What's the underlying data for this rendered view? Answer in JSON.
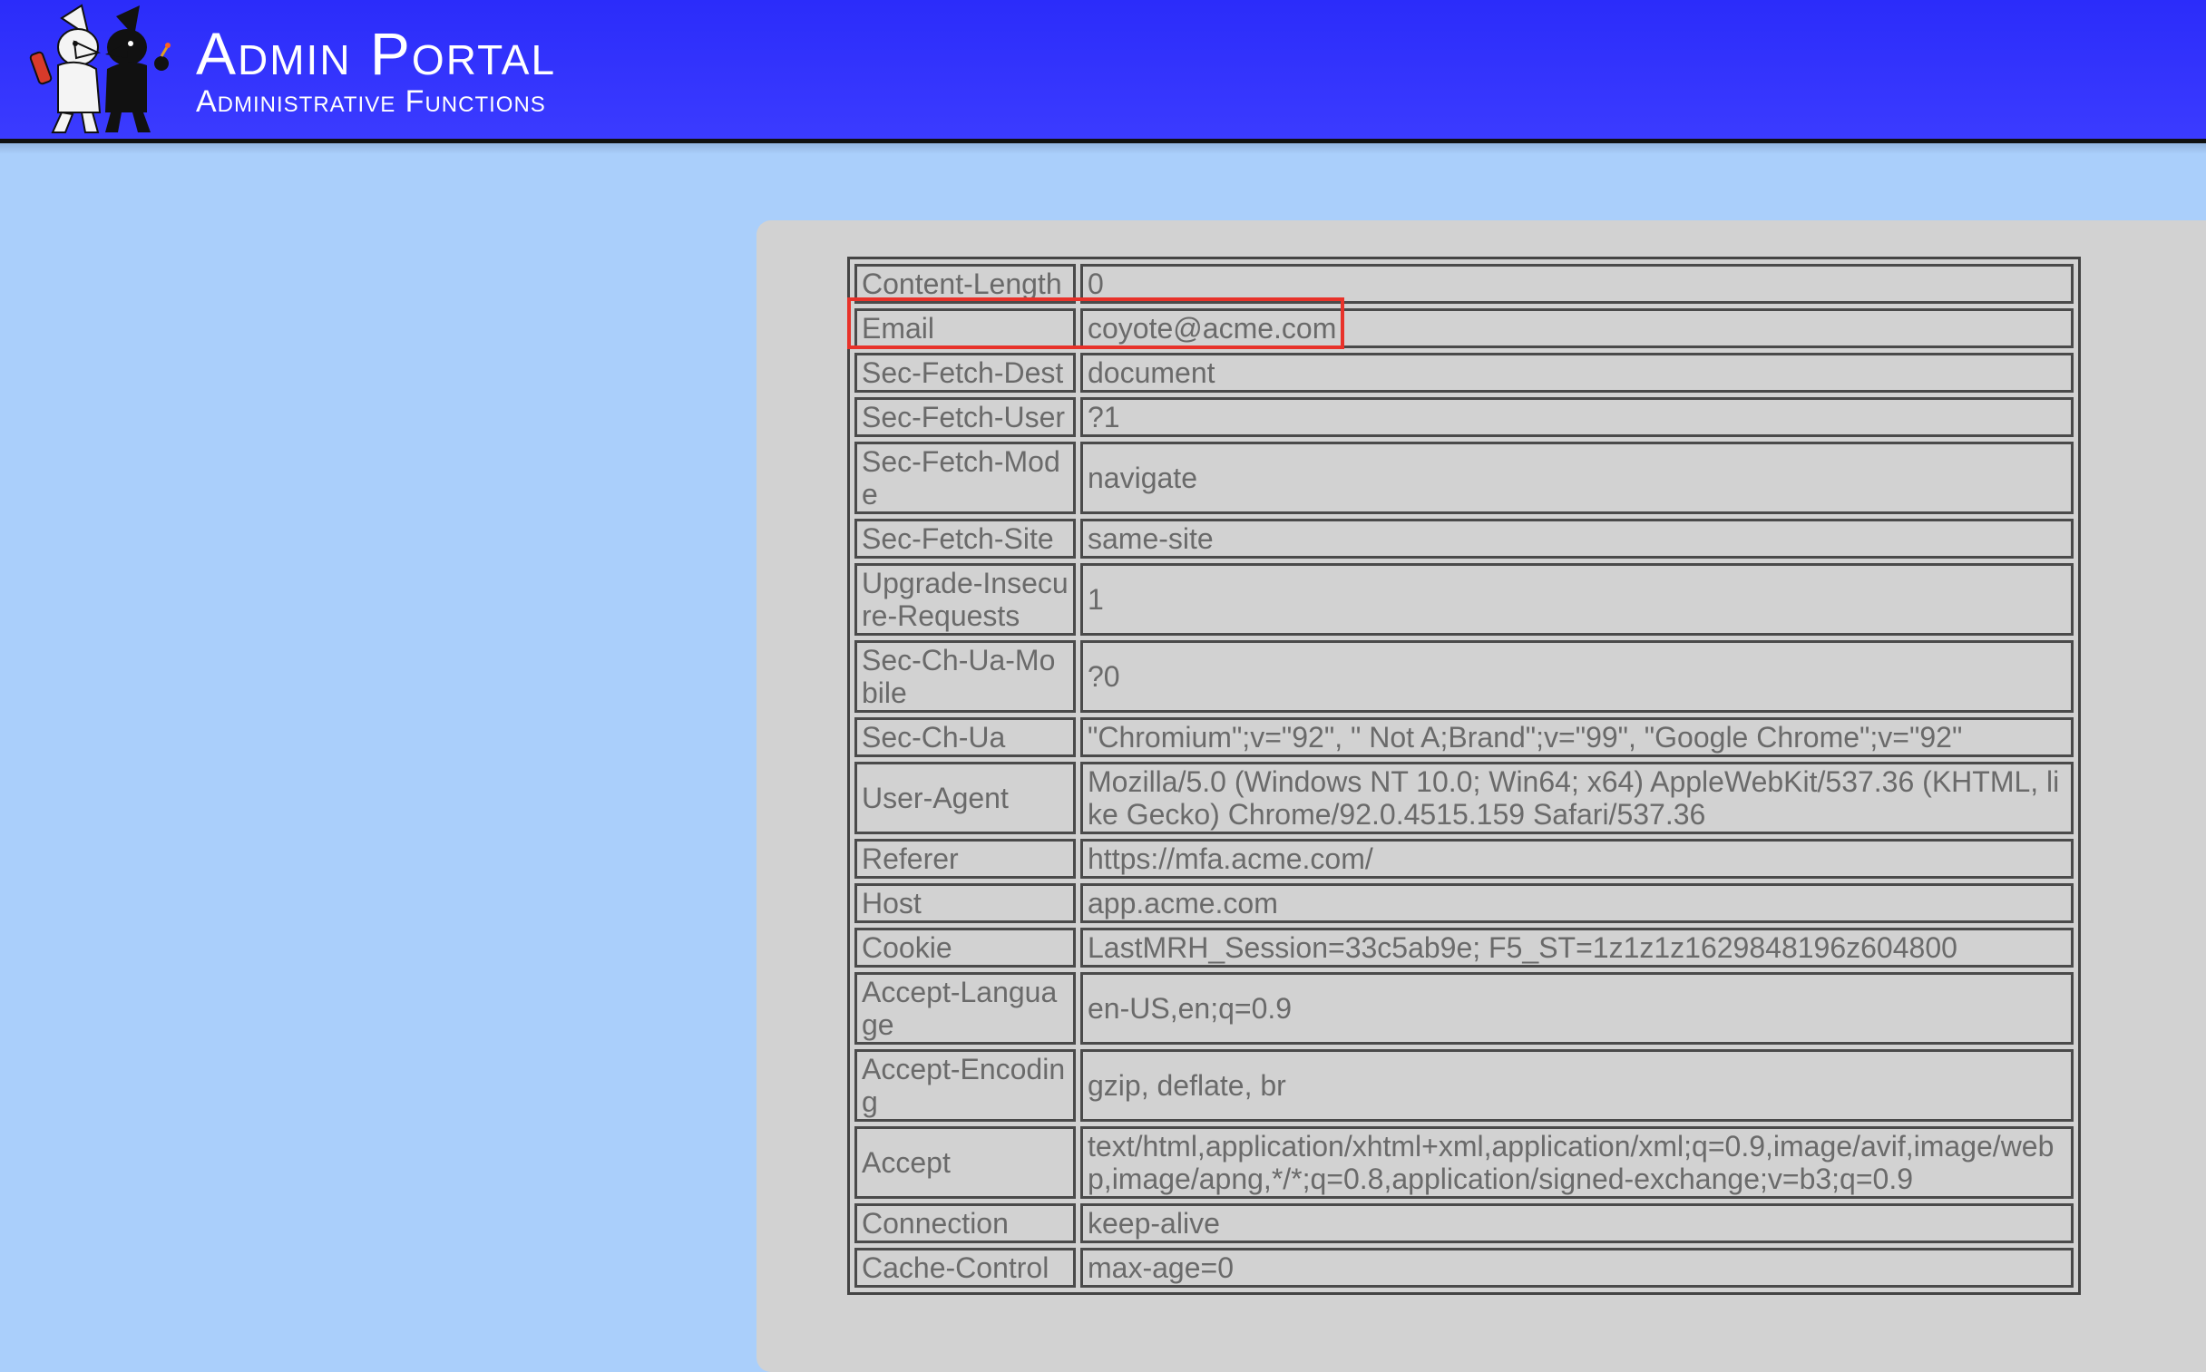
{
  "header": {
    "title": "Admin Portal",
    "subtitle": "Administrative Functions",
    "logo_icon": "spy-vs-spy-logo-icon",
    "background_color": "#3333ff"
  },
  "headers_table": {
    "rows": [
      {
        "key": "Content-Length",
        "value": "0"
      },
      {
        "key": "Email",
        "value": "coyote@acme.com"
      },
      {
        "key": "Sec-Fetch-Dest",
        "value": "document"
      },
      {
        "key": "Sec-Fetch-User",
        "value": "?1"
      },
      {
        "key": "Sec-Fetch-Mode",
        "value": "navigate"
      },
      {
        "key": "Sec-Fetch-Site",
        "value": "same-site"
      },
      {
        "key": "Upgrade-Insecure-Requests",
        "value": "1"
      },
      {
        "key": "Sec-Ch-Ua-Mobile",
        "value": "?0"
      },
      {
        "key": "Sec-Ch-Ua",
        "value": "\"Chromium\";v=\"92\", \" Not A;Brand\";v=\"99\", \"Google Chrome\";v=\"92\""
      },
      {
        "key": "User-Agent",
        "value": "Mozilla/5.0 (Windows NT 10.0; Win64; x64) AppleWebKit/537.36 (KHTML, like Gecko) Chrome/92.0.4515.159 Safari/537.36"
      },
      {
        "key": "Referer",
        "value": "https://mfa.acme.com/"
      },
      {
        "key": "Host",
        "value": "app.acme.com"
      },
      {
        "key": "Cookie",
        "value": "LastMRH_Session=33c5ab9e; F5_ST=1z1z1z1629848196z604800"
      },
      {
        "key": "Accept-Language",
        "value": "en-US,en;q=0.9"
      },
      {
        "key": "Accept-Encoding",
        "value": "gzip, deflate, br"
      },
      {
        "key": "Accept",
        "value": "text/html,application/xhtml+xml,application/xml;q=0.9,image/avif,image/webp,image/apng,*/*;q=0.8,application/signed-exchange;v=b3;q=0.9"
      },
      {
        "key": "Connection",
        "value": "keep-alive"
      },
      {
        "key": "Cache-Control",
        "value": "max-age=0"
      }
    ],
    "highlight_color": "#e8322a"
  }
}
